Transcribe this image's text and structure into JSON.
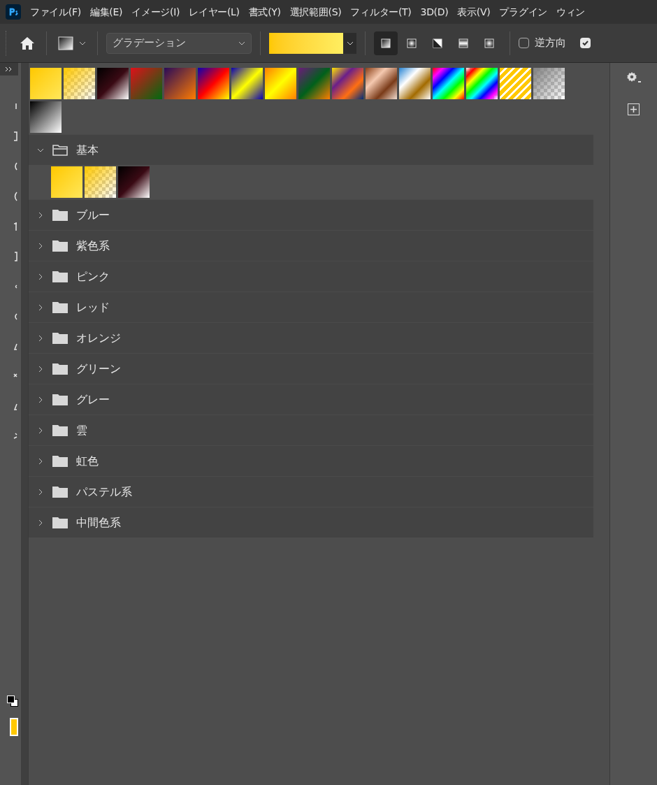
{
  "menu_bar": {
    "items": [
      "ファイル(F)",
      "編集(E)",
      "イメージ(I)",
      "レイヤー(L)",
      "書式(Y)",
      "選択範囲(S)",
      "フィルター(T)",
      "3D(D)",
      "表示(V)",
      "プラグイン",
      "ウィン"
    ]
  },
  "options_bar": {
    "preset_dropdown": {
      "value": "グラデーション"
    },
    "gradient_types": [
      {
        "selected": true
      },
      {
        "selected": false
      },
      {
        "selected": false
      },
      {
        "selected": false
      },
      {
        "selected": false
      }
    ],
    "checkboxes": [
      {
        "label": "逆方向",
        "checked": false
      },
      {
        "checked": true
      }
    ]
  },
  "gradient_panel": {
    "folders": [
      {
        "name": "基本",
        "expanded": true
      },
      {
        "name": "ブルー",
        "expanded": false
      },
      {
        "name": "紫色系",
        "expanded": false
      },
      {
        "name": "ピンク",
        "expanded": false
      },
      {
        "name": "レッド",
        "expanded": false
      },
      {
        "name": "オレンジ",
        "expanded": false
      },
      {
        "name": "グリーン",
        "expanded": false
      },
      {
        "name": "グレー",
        "expanded": false
      },
      {
        "name": "雲",
        "expanded": false
      },
      {
        "name": "虹色",
        "expanded": false
      },
      {
        "name": "パステル系",
        "expanded": false
      },
      {
        "name": "中間色系",
        "expanded": false
      }
    ]
  }
}
